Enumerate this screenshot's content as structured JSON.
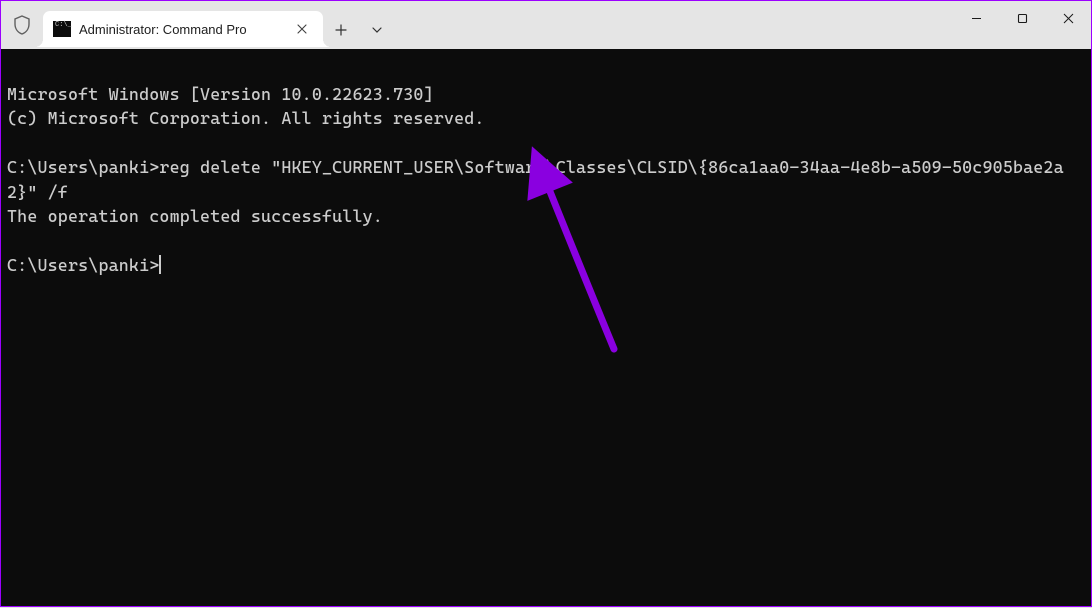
{
  "window": {
    "tab_title": "Administrator: Command Pro"
  },
  "terminal": {
    "banner_line1": "Microsoft Windows [Version 10.0.22623.730]",
    "banner_line2": "(c) Microsoft Corporation. All rights reserved.",
    "prompt1": "C:\\Users\\panki>",
    "command1": "reg delete \"HKEY_CURRENT_USER\\Software\\Classes\\CLSID\\{86ca1aa0-34aa-4e8b-a509-50c905bae2a2}\" /f",
    "result1": "The operation completed successfully.",
    "prompt2": "C:\\Users\\panki>"
  },
  "annotation": {
    "arrow_color": "#8a00e0"
  }
}
